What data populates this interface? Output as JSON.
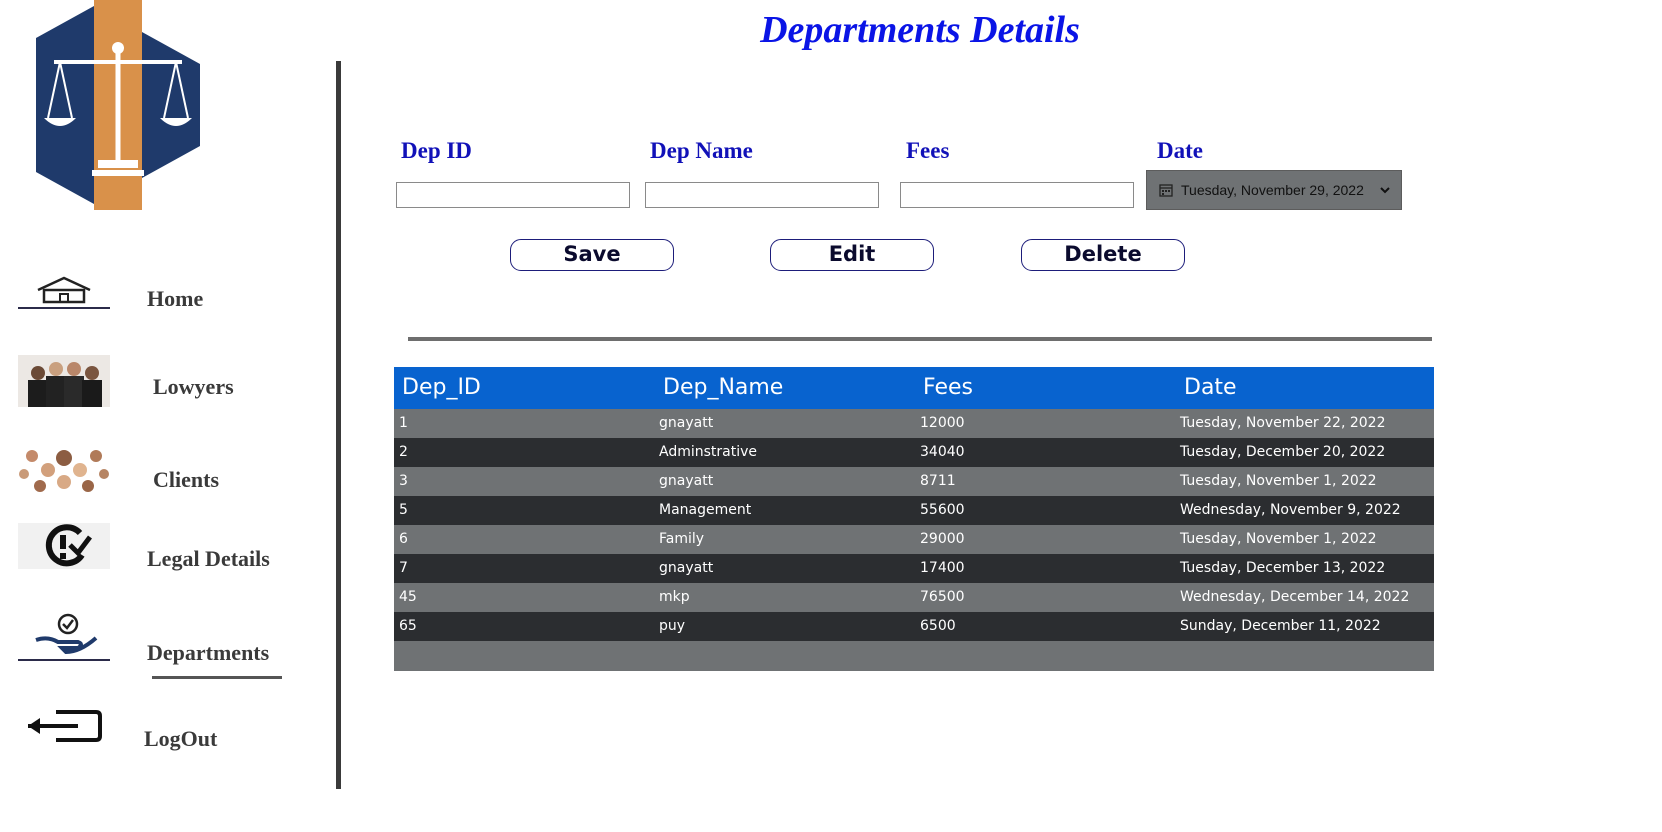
{
  "sidebar": {
    "items": [
      {
        "label": "Home",
        "icon": "home-icon"
      },
      {
        "label": "Lowyers",
        "icon": "lawyers-photo"
      },
      {
        "label": "Clients",
        "icon": "clients-photo"
      },
      {
        "label": "Legal Details",
        "icon": "legal-check-icon"
      },
      {
        "label": "Departments",
        "icon": "hand-check-icon"
      },
      {
        "label": "LogOut",
        "icon": "logout-icon"
      }
    ],
    "active": "Departments"
  },
  "header": {
    "title": "Departments Details"
  },
  "form": {
    "dep_id_label": "Dep ID",
    "dep_name_label": "Dep Name",
    "fees_label": "Fees",
    "date_label": "Date",
    "dep_id_value": "",
    "dep_name_value": "",
    "fees_value": "",
    "date_value": "Tuesday, November 29, 2022"
  },
  "buttons": {
    "save": "Save",
    "edit": "Edit",
    "delete": "Delete"
  },
  "table": {
    "columns": [
      "Dep_ID",
      "Dep_Name",
      "Fees",
      "Date"
    ],
    "rows": [
      [
        "1",
        "gnayatt",
        "12000",
        "Tuesday, November 22, 2022"
      ],
      [
        "2",
        "Adminstrative",
        "34040",
        "Tuesday, December 20, 2022"
      ],
      [
        "3",
        "gnayatt",
        "8711",
        "Tuesday, November 1, 2022"
      ],
      [
        "5",
        "Management",
        "55600",
        "Wednesday, November 9, 2022"
      ],
      [
        "6",
        "Family",
        "29000",
        "Tuesday, November 1, 2022"
      ],
      [
        "7",
        "gnayatt",
        "17400",
        "Tuesday, December 13, 2022"
      ],
      [
        "45",
        "mkp",
        "76500",
        "Wednesday, December 14, 2022"
      ],
      [
        "65",
        "puy",
        "6500",
        "Sunday, December 11, 2022"
      ]
    ]
  },
  "colors": {
    "title": "#0a14e6",
    "label": "#1111b8",
    "header_bg": "#0863cf",
    "row_light": "#6f7274",
    "row_dark": "#2b2d30"
  }
}
